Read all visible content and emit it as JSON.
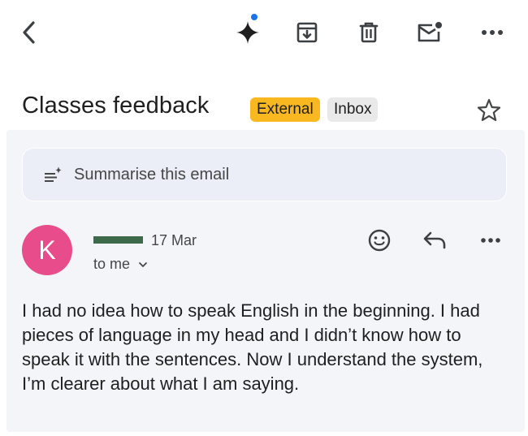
{
  "toolbar": {
    "back_icon": "back-arrow-icon",
    "gemini_icon": "gemini-sparkle-icon",
    "archive_icon": "archive-icon",
    "delete_icon": "delete-icon",
    "unread_icon": "mark-unread-icon",
    "more_icon": "more-icon"
  },
  "email": {
    "subject": "Classes feedback",
    "labels": [
      "External",
      "Inbox"
    ],
    "summarise_label": "Summarise this email",
    "sender_initial": "K",
    "date": "17 Mar",
    "recipient": "to me",
    "body": "I had no idea how to speak English in the beginning. I had pieces of language in my head and I didn’t know how to speak it with the sentences. Now I understand the system, I’m clearer about what I am saying."
  },
  "colors": {
    "external_label": "#f9b820",
    "inbox_label": "#e9e9ea",
    "avatar": "#e94c8a",
    "gemini_dot": "#1a73e8",
    "panel": "#f4f5f9"
  }
}
